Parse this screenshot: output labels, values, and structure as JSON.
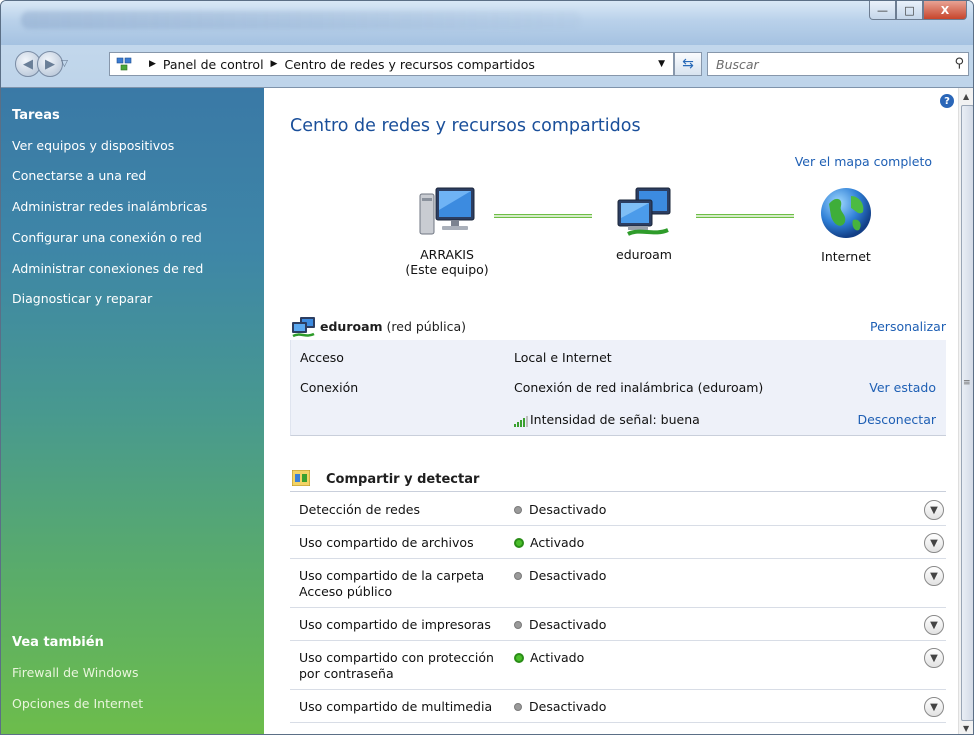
{
  "window": {
    "buttons": {
      "minimize": "—",
      "maximize": "□",
      "close": "X"
    }
  },
  "address_bar": {
    "crumbs": [
      "Panel de control",
      "Centro de redes y recursos compartidos"
    ],
    "search_placeholder": "Buscar"
  },
  "sidebar": {
    "tasks_heading": "Tareas",
    "tasks": [
      "Ver equipos y dispositivos",
      "Conectarse a una red",
      "Administrar redes inalámbricas",
      "Configurar una conexión o red",
      "Administrar conexiones de red",
      "Diagnosticar y reparar"
    ],
    "see_also_heading": "Vea también",
    "see_also": [
      "Firewall de Windows",
      "Opciones de Internet"
    ]
  },
  "main": {
    "title": "Centro de redes y recursos compartidos",
    "map_link": "Ver el mapa completo",
    "nodes": [
      {
        "name": "ARRAKIS",
        "sub": "(Este equipo)"
      },
      {
        "name": "eduroam",
        "sub": ""
      },
      {
        "name": "Internet",
        "sub": ""
      }
    ],
    "network": {
      "name": "eduroam",
      "type": "(red pública)",
      "customize": "Personalizar",
      "access_label": "Acceso",
      "access_value": "Local e Internet",
      "connection_label": "Conexión",
      "connection_value": "Conexión de red inalámbrica (eduroam)",
      "view_status": "Ver estado",
      "signal": "Intensidad de señal: buena",
      "disconnect": "Desconectar"
    },
    "sharing": {
      "heading": "Compartir y detectar",
      "rows": [
        {
          "label": "Detección de redes",
          "status": "Desactivado",
          "on": false
        },
        {
          "label": "Uso compartido de archivos",
          "status": "Activado",
          "on": true
        },
        {
          "label": "Uso compartido de la carpeta\nAcceso público",
          "status": "Desactivado",
          "on": false
        },
        {
          "label": "Uso compartido de impresoras",
          "status": "Desactivado",
          "on": false
        },
        {
          "label": "Uso compartido con protección\npor contraseña",
          "status": "Activado",
          "on": true
        },
        {
          "label": "Uso compartido de multimedia",
          "status": "Desactivado",
          "on": false
        }
      ]
    }
  },
  "colors": {
    "link": "#1e5fb4",
    "title": "#1a4f9a",
    "status_on": "#4bbf2b",
    "status_off": "#9a9a9a"
  }
}
